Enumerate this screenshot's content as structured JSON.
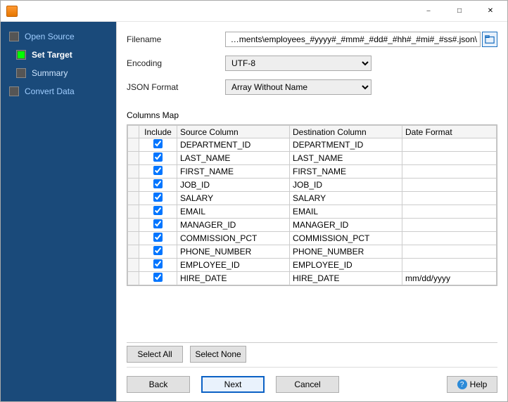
{
  "sidebar": {
    "items": [
      {
        "label": "Open Source"
      },
      {
        "label": "Set Target"
      },
      {
        "label": "Summary"
      },
      {
        "label": "Convert Data"
      }
    ]
  },
  "form": {
    "filename_label": "Filename",
    "filename_value": "\\Documents\\employees_#yyyy#_#mm#_#dd#_#hh#_#mi#_#ss#.json",
    "encoding_label": "Encoding",
    "encoding_value": "UTF-8",
    "jsonformat_label": "JSON Format",
    "jsonformat_value": "Array Without Name"
  },
  "columns_map_label": "Columns Map",
  "grid": {
    "headers": {
      "include": "Include",
      "source": "Source Column",
      "dest": "Destination Column",
      "dateformat": "Date Format"
    },
    "rows": [
      {
        "include": true,
        "source": "DEPARTMENT_ID",
        "dest": "DEPARTMENT_ID",
        "dateformat": ""
      },
      {
        "include": true,
        "source": "LAST_NAME",
        "dest": "LAST_NAME",
        "dateformat": ""
      },
      {
        "include": true,
        "source": "FIRST_NAME",
        "dest": "FIRST_NAME",
        "dateformat": ""
      },
      {
        "include": true,
        "source": "JOB_ID",
        "dest": "JOB_ID",
        "dateformat": ""
      },
      {
        "include": true,
        "source": "SALARY",
        "dest": "SALARY",
        "dateformat": ""
      },
      {
        "include": true,
        "source": "EMAIL",
        "dest": "EMAIL",
        "dateformat": ""
      },
      {
        "include": true,
        "source": "MANAGER_ID",
        "dest": "MANAGER_ID",
        "dateformat": ""
      },
      {
        "include": true,
        "source": "COMMISSION_PCT",
        "dest": "COMMISSION_PCT",
        "dateformat": ""
      },
      {
        "include": true,
        "source": "PHONE_NUMBER",
        "dest": "PHONE_NUMBER",
        "dateformat": ""
      },
      {
        "include": true,
        "source": "EMPLOYEE_ID",
        "dest": "EMPLOYEE_ID",
        "dateformat": ""
      },
      {
        "include": true,
        "source": "HIRE_DATE",
        "dest": "HIRE_DATE",
        "dateformat": "mm/dd/yyyy"
      }
    ]
  },
  "buttons": {
    "select_all": "Select All",
    "select_none": "Select None",
    "back": "Back",
    "next": "Next",
    "cancel": "Cancel",
    "help": "Help"
  }
}
